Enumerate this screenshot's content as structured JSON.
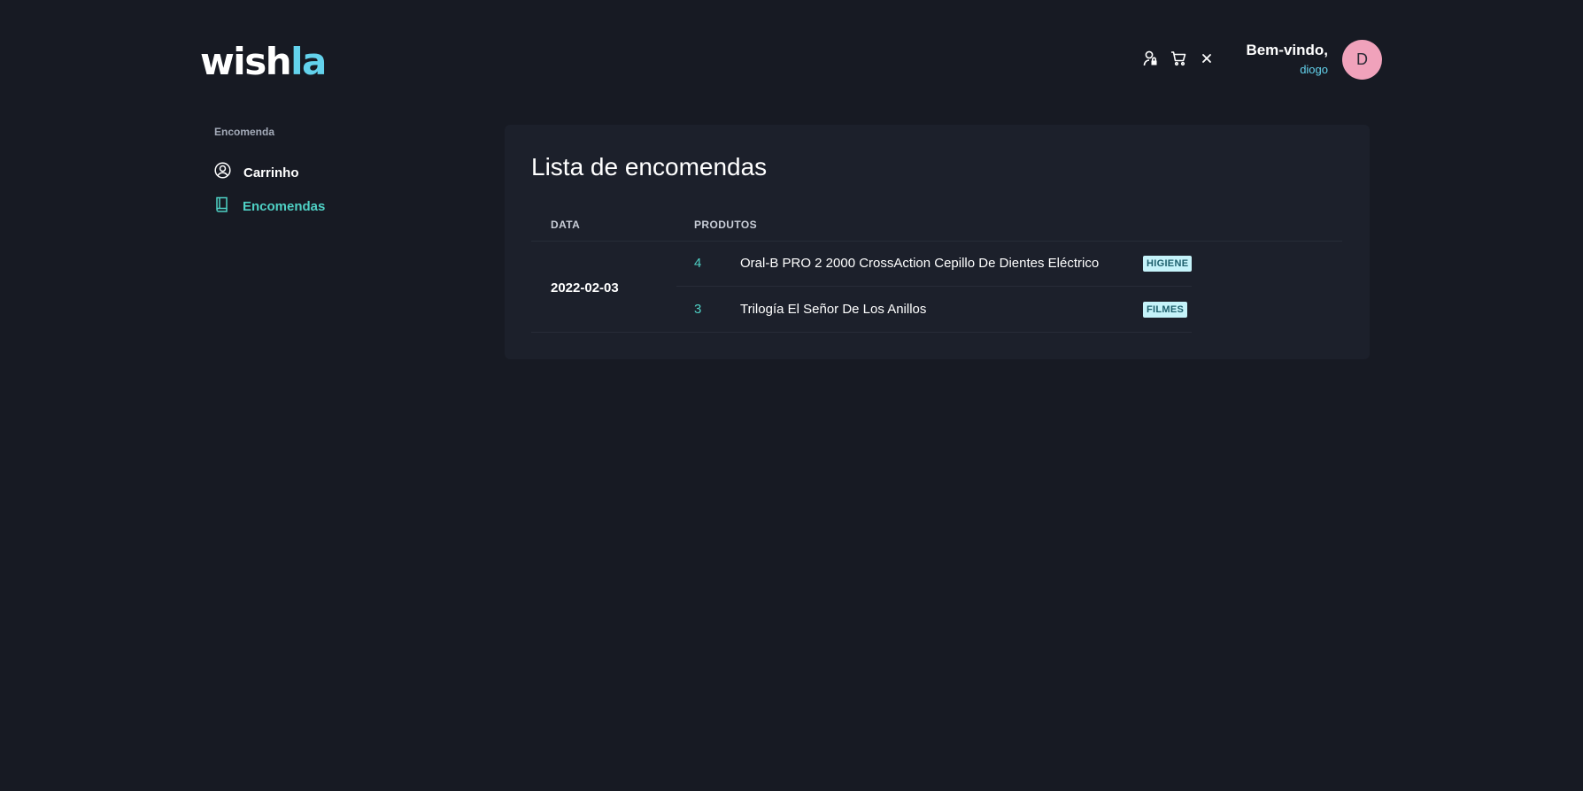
{
  "brand": {
    "logo_part1": "wish",
    "logo_part2": "la"
  },
  "header": {
    "icons": [
      "user-lock-icon",
      "cart-icon",
      "close-icon"
    ],
    "greeting": "Bem-vindo,",
    "username": "diogo",
    "avatar_initial": "D"
  },
  "sidebar": {
    "section_title": "Encomenda",
    "items": [
      {
        "label": "Carrinho",
        "icon": "user-circle-icon"
      },
      {
        "label": "Encomendas",
        "icon": "book-icon",
        "active": true
      }
    ]
  },
  "main": {
    "title": "Lista de encomendas",
    "columns": [
      "DATA",
      "PRODUTOS"
    ],
    "orders": [
      {
        "date": "2022-02-03",
        "products": [
          {
            "qty": "4",
            "name": "Oral-B PRO 2 2000 CrossAction Cepillo De Dientes Eléctrico",
            "category": "HIGIENE"
          },
          {
            "qty": "3",
            "name": "Trilogía El Señor De Los Anillos",
            "category": "FILMES"
          }
        ]
      }
    ]
  },
  "colors": {
    "background": "#171a23",
    "card": "#1c202b",
    "accent": "#63d2ec",
    "active_nav": "#4fd1c5",
    "avatar": "#f0a2bb",
    "badge_bg": "#c5f3fa"
  }
}
